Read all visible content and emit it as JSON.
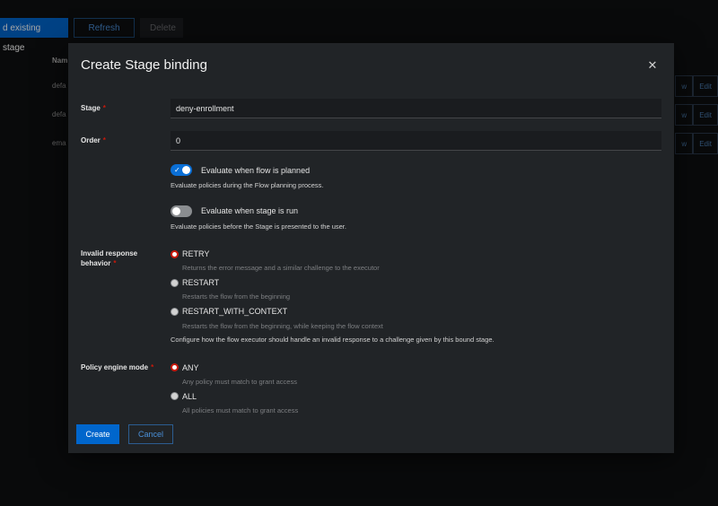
{
  "background": {
    "toolbar": {
      "bind_existing_label": "d existing stage",
      "refresh_label": "Refresh",
      "delete_label": "Delete"
    },
    "table": {
      "name_header": "Nam",
      "rows": [
        {
          "name": "defa",
          "view_label": "w",
          "edit_label": "Edit"
        },
        {
          "name": "defa",
          "view_label": "w",
          "edit_label": "Edit"
        },
        {
          "name": "ema",
          "view_label": "w",
          "edit_label": "Edit"
        }
      ]
    }
  },
  "modal": {
    "title": "Create Stage binding",
    "close_icon": "close-icon",
    "stage": {
      "label": "Stage",
      "required": "*",
      "value": "deny-enrollment"
    },
    "order": {
      "label": "Order",
      "required": "*",
      "value": "0"
    },
    "evaluate_planned": {
      "label": "Evaluate when flow is planned",
      "checked": true,
      "helper": "Evaluate policies during the Flow planning process."
    },
    "evaluate_run": {
      "label": "Evaluate when stage is run",
      "checked": false,
      "helper": "Evaluate policies before the Stage is presented to the user."
    },
    "invalid_response": {
      "label_line1": "Invalid response",
      "label_line2": "behavior",
      "required": "*",
      "options": [
        {
          "label": "RETRY",
          "description": "Returns the error message and a similar challenge to the executor",
          "checked": true
        },
        {
          "label": "RESTART",
          "description": "Restarts the flow from the beginning",
          "checked": false
        },
        {
          "label": "RESTART_WITH_CONTEXT",
          "description": "Restarts the flow from the beginning, while keeping the flow context",
          "checked": false
        }
      ],
      "helper": "Configure how the flow executor should handle an invalid response to a challenge given by this bound stage."
    },
    "policy_engine_mode": {
      "label": "Policy engine mode",
      "required": "*",
      "options": [
        {
          "label": "ANY",
          "description": "Any policy must match to grant access",
          "checked": true
        },
        {
          "label": "ALL",
          "description": "All policies must match to grant access",
          "checked": false
        }
      ]
    },
    "create_label": "Create",
    "cancel_label": "Cancel"
  },
  "colors": {
    "primary": "#0066cc",
    "required": "#c9190b",
    "modal_bg": "#212427"
  }
}
